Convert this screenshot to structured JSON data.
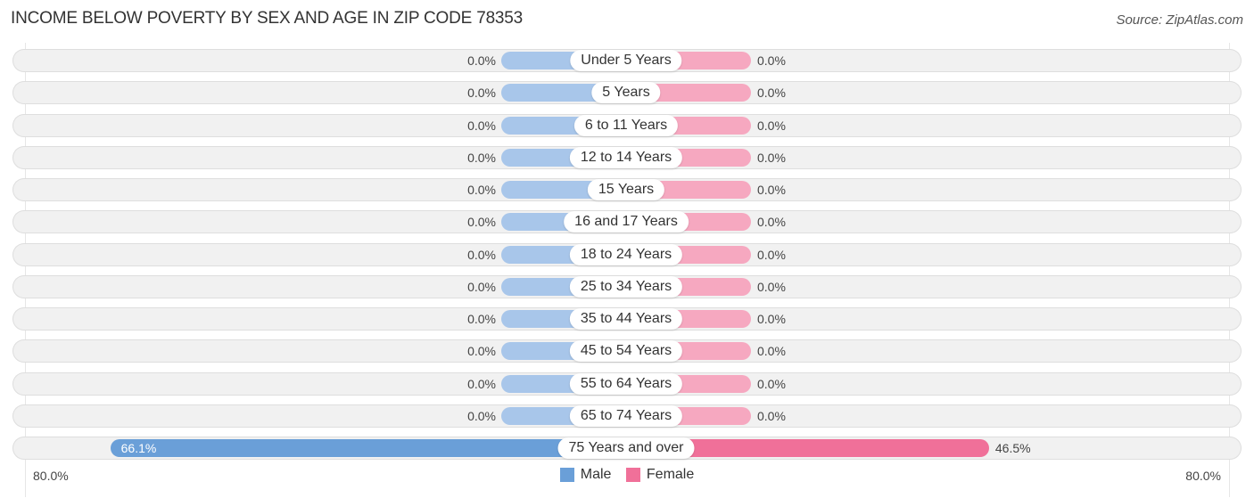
{
  "title": "INCOME BELOW POVERTY BY SEX AND AGE IN ZIP CODE 78353",
  "source": "Source: ZipAtlas.com",
  "colors": {
    "male_full": "#6a9fd8",
    "male_zero": "#a8c6ea",
    "female_full": "#f07099",
    "female_zero": "#f6a8c0"
  },
  "legend": [
    {
      "label": "Male",
      "color": "#6a9fd8"
    },
    {
      "label": "Female",
      "color": "#f07099"
    }
  ],
  "axis": {
    "left_label": "80.0%",
    "right_label": "80.0%"
  },
  "chart_data": {
    "type": "bar",
    "orientation": "horizontal-diverging",
    "title": "INCOME BELOW POVERTY BY SEX AND AGE IN ZIP CODE 78353",
    "categories": [
      "Under 5 Years",
      "5 Years",
      "6 to 11 Years",
      "12 to 14 Years",
      "15 Years",
      "16 and 17 Years",
      "18 to 24 Years",
      "25 to 34 Years",
      "35 to 44 Years",
      "45 to 54 Years",
      "55 to 64 Years",
      "65 to 74 Years",
      "75 Years and over"
    ],
    "series": [
      {
        "name": "Male",
        "values": [
          0,
          0,
          0,
          0,
          0,
          0,
          0,
          0,
          0,
          0,
          0,
          0,
          66.1
        ],
        "labels": [
          "0.0%",
          "0.0%",
          "0.0%",
          "0.0%",
          "0.0%",
          "0.0%",
          "0.0%",
          "0.0%",
          "0.0%",
          "0.0%",
          "0.0%",
          "0.0%",
          "66.1%"
        ]
      },
      {
        "name": "Female",
        "values": [
          0,
          0,
          0,
          0,
          0,
          0,
          0,
          0,
          0,
          0,
          0,
          0,
          46.5
        ],
        "labels": [
          "0.0%",
          "0.0%",
          "0.0%",
          "0.0%",
          "0.0%",
          "0.0%",
          "0.0%",
          "0.0%",
          "0.0%",
          "0.0%",
          "0.0%",
          "0.0%",
          "46.5%"
        ]
      }
    ],
    "xlim": [
      -80,
      80
    ],
    "xlabel_left": "80.0%",
    "xlabel_right": "80.0%",
    "legend": "bottom-center",
    "grid": false
  }
}
